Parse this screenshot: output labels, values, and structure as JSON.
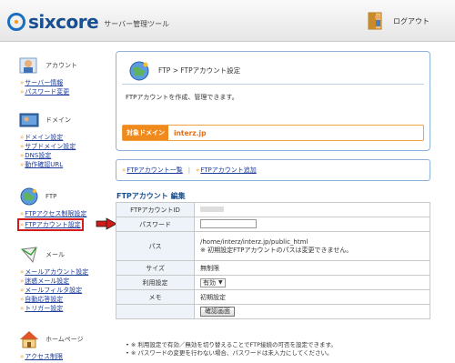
{
  "header": {
    "logo_text": "sixcore",
    "logo_sub": "サーバー管理ツール",
    "logout_label": "ログアウト"
  },
  "sidebar": {
    "sections": [
      {
        "label": "アカウント",
        "icon": "account-icon",
        "links": [
          "サーバー情報",
          "パスワード変更"
        ]
      },
      {
        "label": "ドメイン",
        "icon": "domain-icon",
        "links": [
          "ドメイン設定",
          "サブドメイン設定",
          "DNS設定",
          "動作確認URL"
        ]
      },
      {
        "label": "FTP",
        "icon": "ftp-globe-icon",
        "links": [
          "FTPアクセス制限設定",
          "FTPアカウント設定"
        ]
      },
      {
        "label": "メール",
        "icon": "mail-icon",
        "links": [
          "メールアカウント設定",
          "迷惑メール設定",
          "メールフィルタ設定",
          "自動応答設定",
          "トリガー設定"
        ]
      },
      {
        "label": "ホームページ",
        "icon": "homepage-icon",
        "links": [
          "アクセス制限"
        ]
      }
    ],
    "active_link": "FTPアカウント設定"
  },
  "panel": {
    "crumb_root": "FTP",
    "crumb_sep": ">",
    "crumb_current": "FTPアカウント設定",
    "description": "FTPアカウントを作成、管理できます。",
    "domain_tag": "対象ドメイン",
    "domain_value": "interz.jp"
  },
  "subnav": {
    "list_label": "FTPアカウント一覧",
    "sep": "|",
    "add_label": "FTPアカウント追加"
  },
  "form": {
    "title": "FTPアカウント 編集",
    "rows": {
      "id_label": "FTPアカウントID",
      "id_value": "",
      "password_label": "パスワード",
      "password_value": "",
      "path_label": "パス",
      "path_value": "/home/interz/interz.jp/public_html",
      "path_note": "※ 初期設定FTPアカウントのパスは変更できません。",
      "size_label": "サイズ",
      "size_value": "無制限",
      "status_label": "利用設定",
      "status_value": "有効",
      "memo_label": "メモ",
      "memo_value": "初期設定"
    },
    "confirm_label": "確認画面"
  },
  "notes": [
    "• ※ 利用設定で有効／無効を切り替えることでFTP接続の可否を設定できます。",
    "• ※ パスワードの変更を行わない場合、パスワードは未入力にしてください。"
  ],
  "colors": {
    "link": "#1d3c9c",
    "accent_orange": "#f08a1c",
    "panel_border": "#8fb2da",
    "highlight_red": "#d21a1a"
  }
}
